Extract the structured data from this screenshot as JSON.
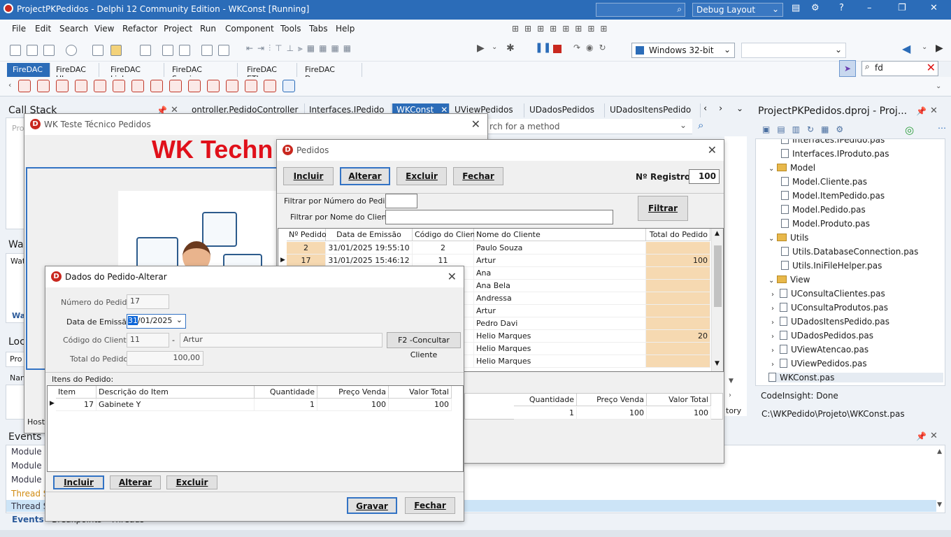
{
  "titlebar": {
    "title": "ProjectPKPedidos - Delphi 12 Community Edition - WKConst [Running]",
    "layout": "Debug Layout"
  },
  "menu": [
    "File",
    "Edit",
    "Search",
    "View",
    "Refactor",
    "Project",
    "Run",
    "Component",
    "Tools",
    "Tabs",
    "Help"
  ],
  "platform": "Windows 32-bit",
  "palette_tabs": [
    "FireDAC",
    "FireDAC UI",
    "FireDAC Links",
    "FireDAC Services",
    "FireDAC ETL",
    "FireDAC Devs"
  ],
  "palette_search": "fd",
  "panels": {
    "call_stack": "Call Stack",
    "call_stack_item": "Pro",
    "watches": "Wa",
    "watches_item": "Wat",
    "watches_tab": "Wa",
    "locals": "Loc",
    "locals_input": "Pro",
    "locals_col": "Nan",
    "events": "Events",
    "events_items": [
      "Module L",
      "Module L",
      "Module L",
      "Thread St",
      "Thread St"
    ],
    "events_tabs": [
      "Events",
      "Breakpoints",
      "Threads"
    ],
    "host": "Host"
  },
  "editor_tabs": [
    "ontroller.PedidoController",
    "Interfaces.IPedido",
    "WKConst",
    "UViewPedidos",
    "UDadosPedidos",
    "UDadosItensPedido"
  ],
  "editor_search": "rch for a method",
  "project": {
    "title": "ProjectPKPedidos.dproj - Proj...",
    "items": [
      {
        "label": "Interfaces.IPedido.pas",
        "type": "file",
        "indent": 2
      },
      {
        "label": "Interfaces.IProduto.pas",
        "type": "file",
        "indent": 2
      },
      {
        "label": "Model",
        "type": "folder",
        "indent": 1
      },
      {
        "label": "Model.Cliente.pas",
        "type": "file",
        "indent": 2
      },
      {
        "label": "Model.ItemPedido.pas",
        "type": "file",
        "indent": 2
      },
      {
        "label": "Model.Pedido.pas",
        "type": "file",
        "indent": 2
      },
      {
        "label": "Model.Produto.pas",
        "type": "file",
        "indent": 2
      },
      {
        "label": "Utils",
        "type": "folder",
        "indent": 1
      },
      {
        "label": "Utils.DatabaseConnection.pas",
        "type": "file",
        "indent": 2
      },
      {
        "label": "Utils.IniFileHelper.pas",
        "type": "file",
        "indent": 2
      },
      {
        "label": "View",
        "type": "folder",
        "indent": 1
      },
      {
        "label": "UConsultaClientes.pas",
        "type": "unit",
        "indent": 2
      },
      {
        "label": "UConsultaProdutos.pas",
        "type": "unit",
        "indent": 2
      },
      {
        "label": "UDadosItensPedido.pas",
        "type": "unit",
        "indent": 2
      },
      {
        "label": "UDadosPedidos.pas",
        "type": "unit",
        "indent": 2
      },
      {
        "label": "UViewAtencao.pas",
        "type": "unit",
        "indent": 2
      },
      {
        "label": "UViewPedidos.pas",
        "type": "unit",
        "indent": 2
      },
      {
        "label": "WKConst.pas",
        "type": "file",
        "indent": 1
      }
    ],
    "codeinsight": "CodeInsight: Done",
    "path": "C:\\WKPedido\\Projeto\\WKConst.pas",
    "history": "tory"
  },
  "wk_window": {
    "title": "WK Teste Técnico Pedidos",
    "banner": "WK Techn"
  },
  "pedidos": {
    "title": "Pedidos",
    "buttons": {
      "incluir": "Incluir",
      "alterar": "Alterar",
      "excluir": "Excluir",
      "fechar": "Fechar"
    },
    "registros_label": "Nº Registros:",
    "registros_value": "100",
    "filtro_numero_label": "Filtrar por Número do Pedido:",
    "filtro_nome_label": "Filtrar por Nome do Cliente:",
    "filtrar": "Filtrar",
    "columns": [
      "Nº Pedido",
      "Data de Emissão",
      "Código do Cliente",
      "Nome do Cliente",
      "Total do Pedido"
    ],
    "rows": [
      {
        "num": "2",
        "data": "31/01/2025 19:55:10",
        "cod": "2",
        "nome": "Paulo Souza",
        "total": ""
      },
      {
        "num": "17",
        "data": "31/01/2025 15:46:12",
        "cod": "11",
        "nome": "Artur",
        "total": "100"
      },
      {
        "num": "",
        "data": "",
        "cod": "",
        "nome": "Ana",
        "total": ""
      },
      {
        "num": "",
        "data": "",
        "cod": "",
        "nome": "Ana Bela",
        "total": ""
      },
      {
        "num": "",
        "data": "",
        "cod": "",
        "nome": "Andressa",
        "total": ""
      },
      {
        "num": "",
        "data": "",
        "cod": "",
        "nome": "Artur",
        "total": ""
      },
      {
        "num": "",
        "data": "",
        "cod": "",
        "nome": "Pedro Davi",
        "total": ""
      },
      {
        "num": "",
        "data": "",
        "cod": "",
        "nome": "Helio Marques",
        "total": "20"
      },
      {
        "num": "",
        "data": "",
        "cod": "",
        "nome": "Helio Marques",
        "total": ""
      },
      {
        "num": "",
        "data": "",
        "cod": "",
        "nome": "Helio Marques",
        "total": ""
      }
    ],
    "items_columns": [
      "Quantidade",
      "Preço Venda",
      "Valor Total"
    ],
    "items_row": [
      "1",
      "100",
      "100"
    ]
  },
  "dados": {
    "title": "Dados do Pedido-Alterar",
    "numero_label": "Número do Pedido:",
    "numero_value": "17",
    "data_label": "Data de Emissão:",
    "data_value_sel": "31",
    "data_value_rest": "/01/2025",
    "codigo_label": "Código do Cliente:",
    "codigo_value": "11",
    "dash": "-",
    "cliente_nome": "Artur",
    "consultar": "F2 -Concultar Cliente",
    "total_label": "Total do Pedido:",
    "total_value": "100,00",
    "itens_label": "Itens do Pedido:",
    "itens_columns": [
      "Item",
      "Descrição do Item",
      "Quantidade",
      "Preço Venda",
      "Valor Total"
    ],
    "itens_row": [
      "17",
      "Gabinete Y",
      "1",
      "100",
      "100"
    ],
    "buttons": {
      "incluir": "Incluir",
      "alterar": "Alterar",
      "excluir": "Excluir",
      "gravar": "Gravar",
      "fechar": "Fechar"
    }
  }
}
